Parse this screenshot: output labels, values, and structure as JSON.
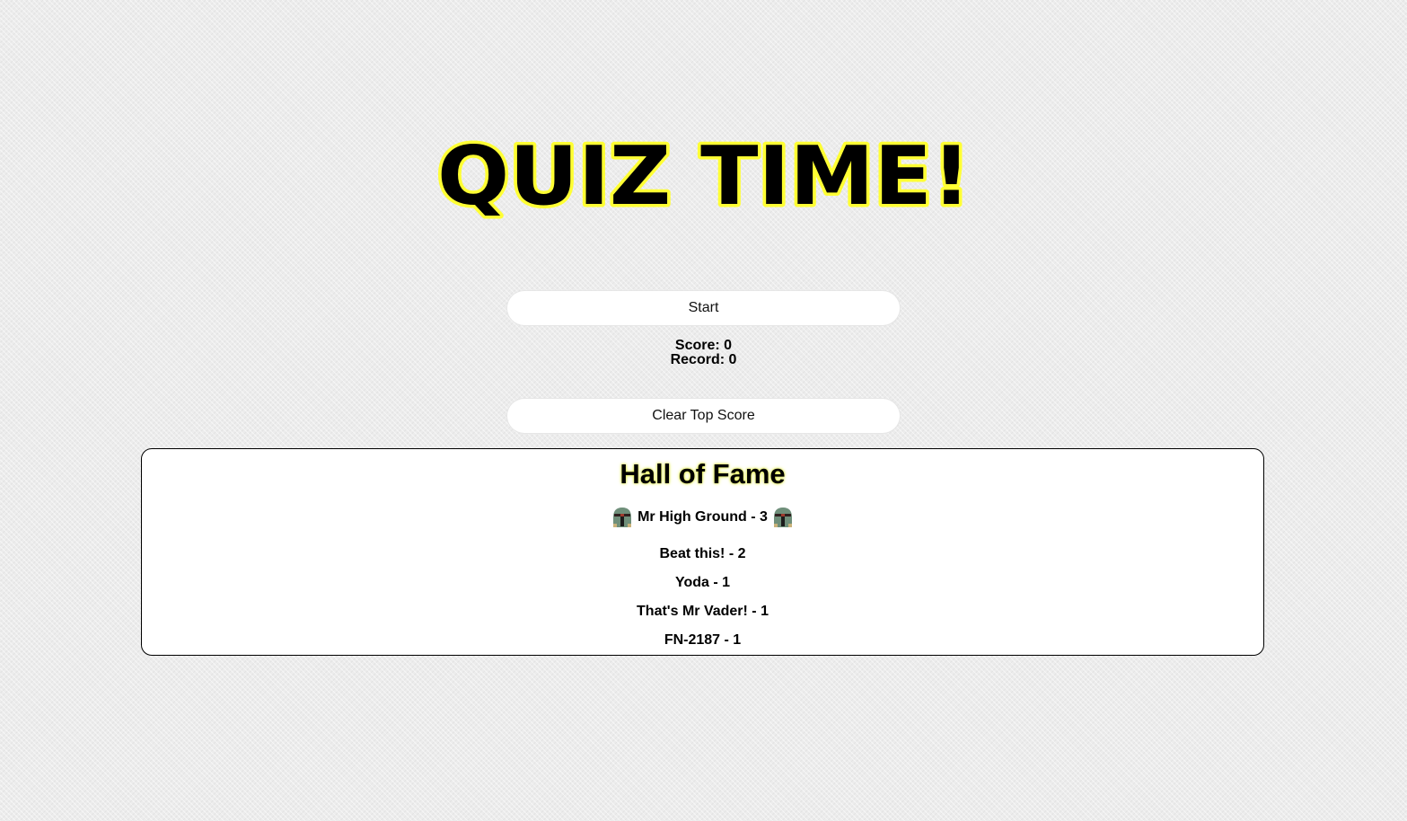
{
  "header": {
    "title": "QUIZ TIME!",
    "title_fill": "#000000",
    "title_stroke": "#ffff33"
  },
  "controls": {
    "start_label": "Start",
    "clear_label": "Clear Top Score"
  },
  "stats": {
    "score": "Score: 0",
    "record": "Record: 0"
  },
  "hall_of_fame": {
    "title": "Hall of Fame",
    "top_icon": "bounty-hunter-helmet-icon",
    "top_entry": "Mr High Ground - 3",
    "entries": [
      "Beat this! - 2",
      "Yoda - 1",
      "That's Mr Vader! - 1",
      "FN-2187 - 1"
    ]
  }
}
